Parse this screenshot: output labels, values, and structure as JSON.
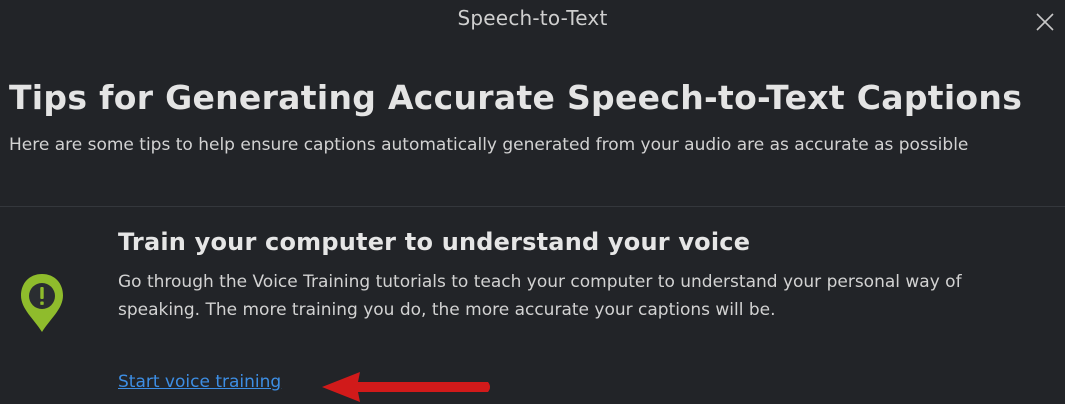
{
  "window": {
    "title": "Speech-to-Text",
    "close_icon": "close-icon"
  },
  "header": {
    "heading": "Tips for Generating Accurate Speech-to-Text Captions",
    "subheading": "Here are some tips to help ensure captions automatically generated from your audio are as accurate as possible"
  },
  "tip": {
    "icon": "exclamation-pin-icon",
    "title": "Train your computer to understand your voice",
    "body": "Go through the Voice Training tutorials to teach your computer to understand your personal way of speaking. The more training you do, the more accurate your captions will be.",
    "link_label": "Start voice training"
  },
  "annotation": {
    "arrow_icon": "red-arrow-icon",
    "arrow_color": "#d11a1a"
  },
  "colors": {
    "background": "#222428",
    "link": "#3d8ee4",
    "icon_green": "#8fbc2c"
  }
}
